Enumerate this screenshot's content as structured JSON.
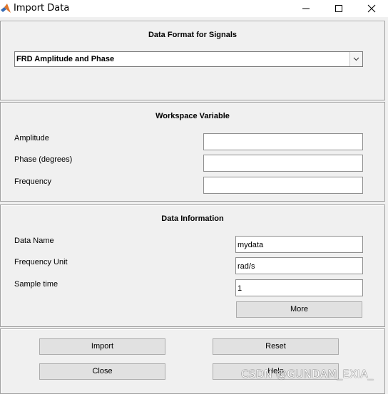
{
  "window": {
    "title": "Import Data",
    "icon": "matlab-logo-icon",
    "controls": [
      "minimize-icon",
      "maximize-icon",
      "close-icon"
    ]
  },
  "format_panel": {
    "title": "Data Format for Signals",
    "selected_format": "FRD Amplitude and Phase"
  },
  "workspace_panel": {
    "title": "Workspace Variable",
    "amplitude_label": "Amplitude",
    "amplitude_value": "",
    "phase_label": "Phase (degrees)",
    "phase_value": "",
    "frequency_label": "Frequency",
    "frequency_value": ""
  },
  "info_panel": {
    "title": "Data Information",
    "data_name_label": "Data Name",
    "data_name_value": "mydata",
    "frequency_unit_label": "Frequency Unit",
    "frequency_unit_value": "rad/s",
    "sample_time_label": "Sample time",
    "sample_time_value": "1",
    "more_label": "More"
  },
  "buttons": {
    "import": "Import",
    "reset": "Reset",
    "close": "Close",
    "help": "Help"
  },
  "watermark": "CSDN @GUNDAM_EXIA_"
}
